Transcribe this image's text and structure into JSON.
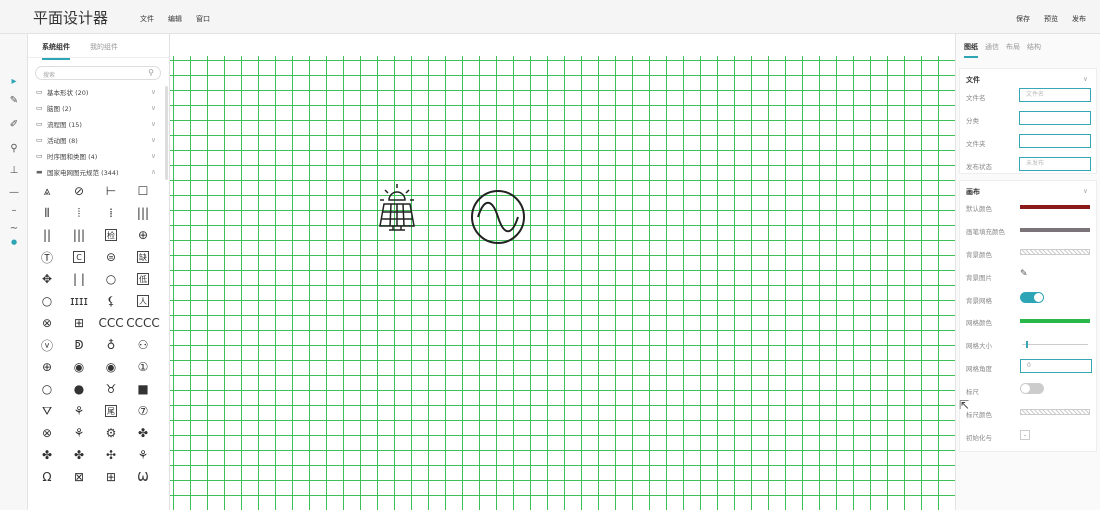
{
  "app": {
    "title": "平面设计器",
    "menu": [
      "文件",
      "编辑",
      "窗口"
    ],
    "actions": [
      "保存",
      "预览",
      "发布"
    ]
  },
  "tools": [
    "select-arrow-icon",
    "pen-icon",
    "pencil-icon",
    "zoom-icon",
    "stamp-icon",
    "line-icon",
    "minus-icon",
    "wave-icon",
    "dot-icon"
  ],
  "library": {
    "tabs": [
      "系统组件",
      "我的组件"
    ],
    "search_placeholder": "搜索",
    "categories": [
      {
        "label": "基本形状 (20)",
        "expanded": false
      },
      {
        "label": "脑图 (2)",
        "expanded": false
      },
      {
        "label": "流程图 (15)",
        "expanded": false
      },
      {
        "label": "活动图 (8)",
        "expanded": false
      },
      {
        "label": "时序图和类图 (4)",
        "expanded": false
      },
      {
        "label": "国家电网图元规范 (344)",
        "expanded": true
      }
    ],
    "symbols": [
      [
        "⩓",
        "⊘",
        "⊢",
        "☐"
      ],
      [
        "⦀",
        "⦙",
        "⁞",
        "|||"
      ],
      [
        "||",
        "|||",
        "检",
        "⊕"
      ],
      [
        "Ⓣ",
        "C",
        "⊜",
        "缺"
      ],
      [
        "✥",
        "| |",
        "○",
        "低"
      ],
      [
        "○",
        "ɪɪɪɪ",
        "⚸",
        "人"
      ],
      [
        "⊗",
        "⊞",
        "ⅭⅭⅭ",
        "ⅭⅭⅭⅭ"
      ],
      [
        "ⓥ",
        "ↁ",
        "♁",
        "⚇"
      ],
      [
        "⊕",
        "◉",
        "◉",
        "①"
      ],
      [
        "○",
        "●",
        "♉",
        "■"
      ],
      [
        "⛛",
        "⚘",
        "尾",
        "⑦"
      ],
      [
        "⊗",
        "⚘",
        "⚙",
        "✤"
      ],
      [
        "✤",
        "✤",
        "✣",
        "⚘"
      ],
      [
        "Ω",
        "⊠",
        "⊞",
        "Ѡ"
      ]
    ]
  },
  "right_panel": {
    "tabs": [
      "图纸",
      "通信",
      "布局",
      "结构"
    ],
    "file_section": {
      "title": "文件",
      "fields": [
        {
          "label": "文件名",
          "placeholder": "文件名"
        },
        {
          "label": "分类",
          "placeholder": ""
        },
        {
          "label": "文件夹",
          "placeholder": ""
        },
        {
          "label": "发布状态",
          "placeholder": "未发布"
        }
      ]
    },
    "canvas_section": {
      "title": "画布",
      "props": {
        "default_color": {
          "label": "默认颜色",
          "color": "#8b1a1a"
        },
        "pen_fill_color": {
          "label": "画笔填充颜色",
          "color": "#7a7478"
        },
        "bg_color": {
          "label": "背景颜色"
        },
        "bg_image": {
          "label": "背景图片"
        },
        "bg_grid": {
          "label": "背景网格",
          "on": true
        },
        "grid_color": {
          "label": "网格颜色",
          "color": "#2bb84a"
        },
        "grid_size": {
          "label": "网格大小"
        },
        "grid_angle": {
          "label": "网格角度",
          "value": "0"
        },
        "ruler": {
          "label": "标尺",
          "on": false
        },
        "ruler_color": {
          "label": "标尺颜色"
        },
        "init": {
          "label": "初始化与"
        }
      }
    },
    "accent": "#2ea5b5"
  },
  "canvas": {
    "items": [
      "solar-panel-icon",
      "ac-source-icon"
    ],
    "grid_color": "#3fbf5a"
  }
}
